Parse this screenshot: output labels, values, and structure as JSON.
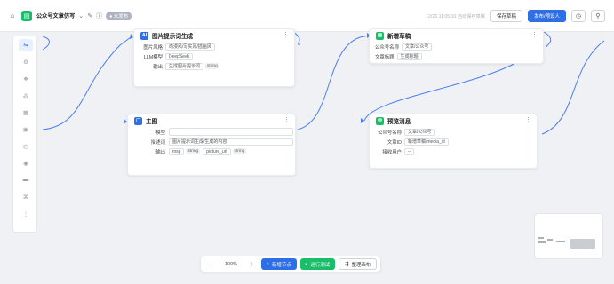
{
  "header": {
    "title": "公众号文章仿写",
    "status": "未发布",
    "save_time": "12/26 11:05:10 自动保存草稿",
    "save_draft": "保存草稿",
    "publish": "发布/预设人"
  },
  "nodes": {
    "image_prompt": {
      "title": "图片提示词生成",
      "fields": [
        {
          "label": "图片风格",
          "value": "动漫风/写实风/插画风"
        },
        {
          "label": "LLM模型",
          "value": "DeepSeek"
        },
        {
          "label": "输出",
          "value": "生成图片提示词",
          "tag": "string"
        }
      ]
    },
    "main": {
      "title": "主图",
      "model_label": "模型",
      "desc_label": "描述词",
      "desc_value": "图片提示词生成/生成的内容",
      "output_label": "输出",
      "outputs": [
        {
          "name": "msg",
          "type": "string"
        },
        {
          "name": "picture_url",
          "type": "string"
        }
      ]
    },
    "new_draft": {
      "title": "新增草稿",
      "fields": [
        {
          "label": "公众号名称",
          "value": "文章/公众号"
        },
        {
          "label": "文章标题",
          "value": "生成标题"
        }
      ]
    },
    "preview": {
      "title": "预览消息",
      "fields": [
        {
          "label": "公众号名称",
          "value": "文章/公众号"
        },
        {
          "label": "文章ID",
          "value": "新增草稿/media_id"
        },
        {
          "label": "接收用户",
          "value": "--"
        }
      ]
    }
  },
  "toolbar": {
    "zoom": "100%",
    "add_node": "新增节点",
    "run_test": "运行测试",
    "layout": "整理画布"
  },
  "colors": {
    "primary": "#2f6fe5",
    "green": "#19be6b",
    "edge": "#4a7ff0"
  }
}
